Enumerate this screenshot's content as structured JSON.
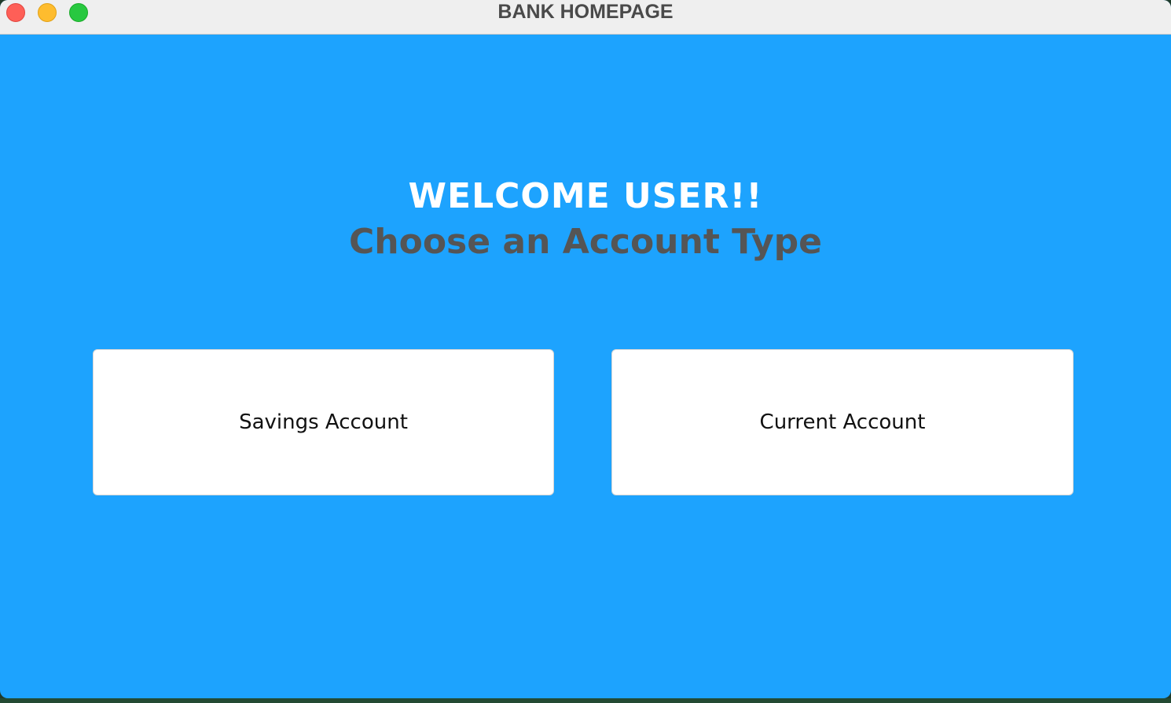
{
  "window": {
    "title": "BANK HOMEPAGE",
    "controls": [
      "close",
      "minimize",
      "zoom"
    ]
  },
  "main": {
    "welcome": "WELCOME USER!!",
    "subtitle": "Choose an Account Type",
    "buttons": {
      "savings": "Savings Account",
      "current": "Current Account"
    }
  },
  "colors": {
    "background": "#1da3fe",
    "welcome_text": "#ffffff",
    "subtitle_text": "#555555",
    "button_bg": "#ffffff"
  }
}
